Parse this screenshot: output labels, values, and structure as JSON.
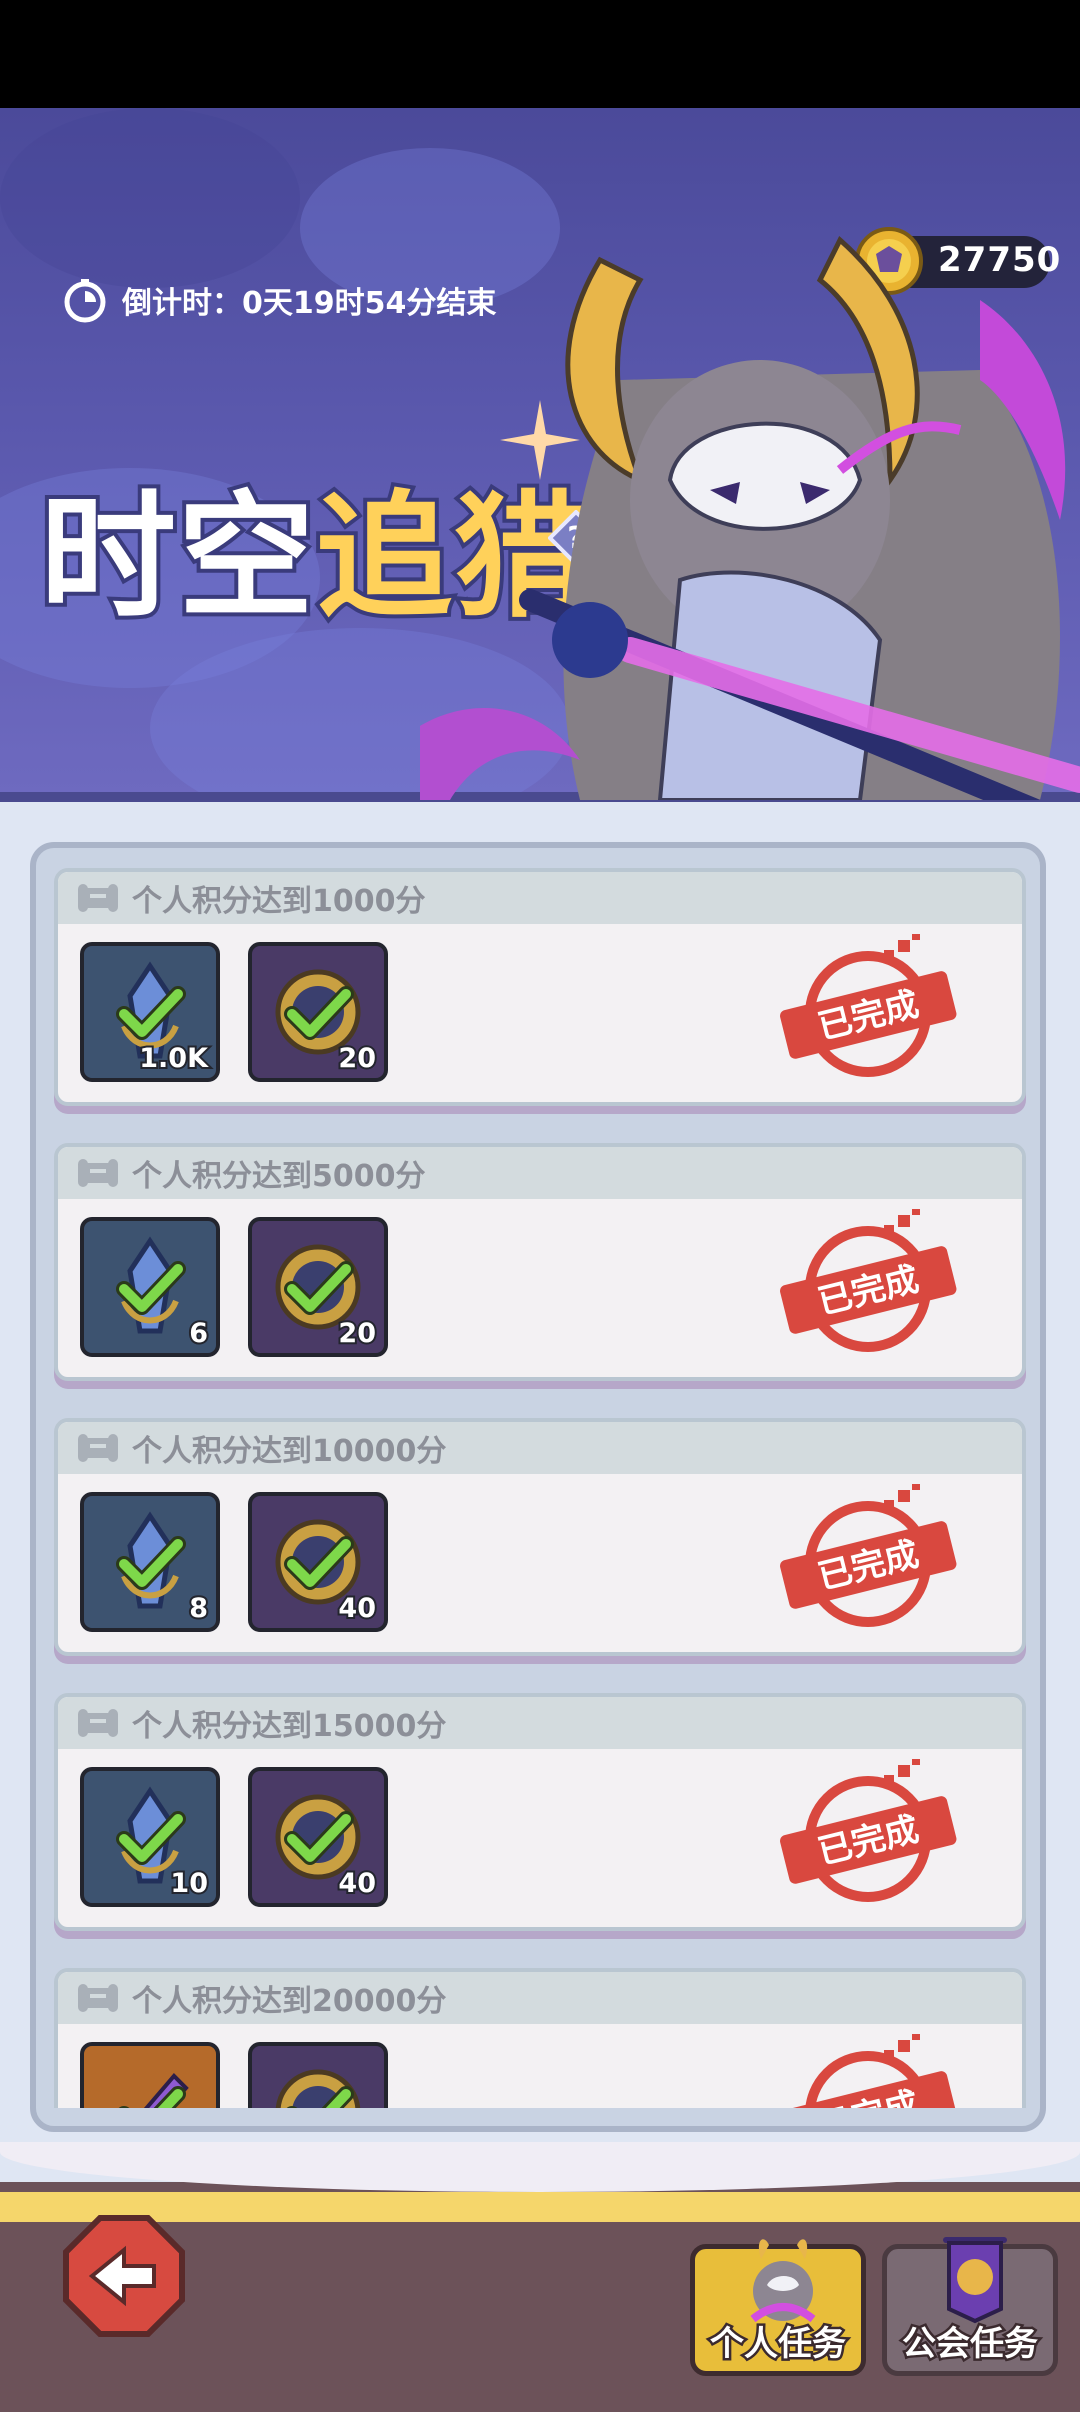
{
  "event": {
    "title_part1": "时空",
    "title_part2": "追猎",
    "countdown": "倒计时：0天19时54分结束",
    "currency_value": "27750"
  },
  "tasks": [
    {
      "label": "个人积分达到1000分",
      "status": "已完成",
      "rewards": [
        {
          "type": "blue",
          "qty": "1.0K"
        },
        {
          "type": "purple",
          "qty": "20"
        }
      ]
    },
    {
      "label": "个人积分达到5000分",
      "status": "已完成",
      "rewards": [
        {
          "type": "blue",
          "qty": "6"
        },
        {
          "type": "purple",
          "qty": "20"
        }
      ]
    },
    {
      "label": "个人积分达到10000分",
      "status": "已完成",
      "rewards": [
        {
          "type": "blue",
          "qty": "8"
        },
        {
          "type": "purple",
          "qty": "40"
        }
      ]
    },
    {
      "label": "个人积分达到15000分",
      "status": "已完成",
      "rewards": [
        {
          "type": "blue",
          "qty": "10"
        },
        {
          "type": "purple",
          "qty": "40"
        }
      ]
    },
    {
      "label": "个人积分达到20000分",
      "status": "已完成",
      "rewards": [
        {
          "type": "orange",
          "qty": ""
        },
        {
          "type": "purple",
          "qty": ""
        }
      ]
    }
  ],
  "tabs": {
    "personal": "个人任务",
    "guild": "公会任务"
  },
  "colors": {
    "check": "#7ed84a",
    "stamp": "#d9483f",
    "accent": "#ffd15a"
  }
}
